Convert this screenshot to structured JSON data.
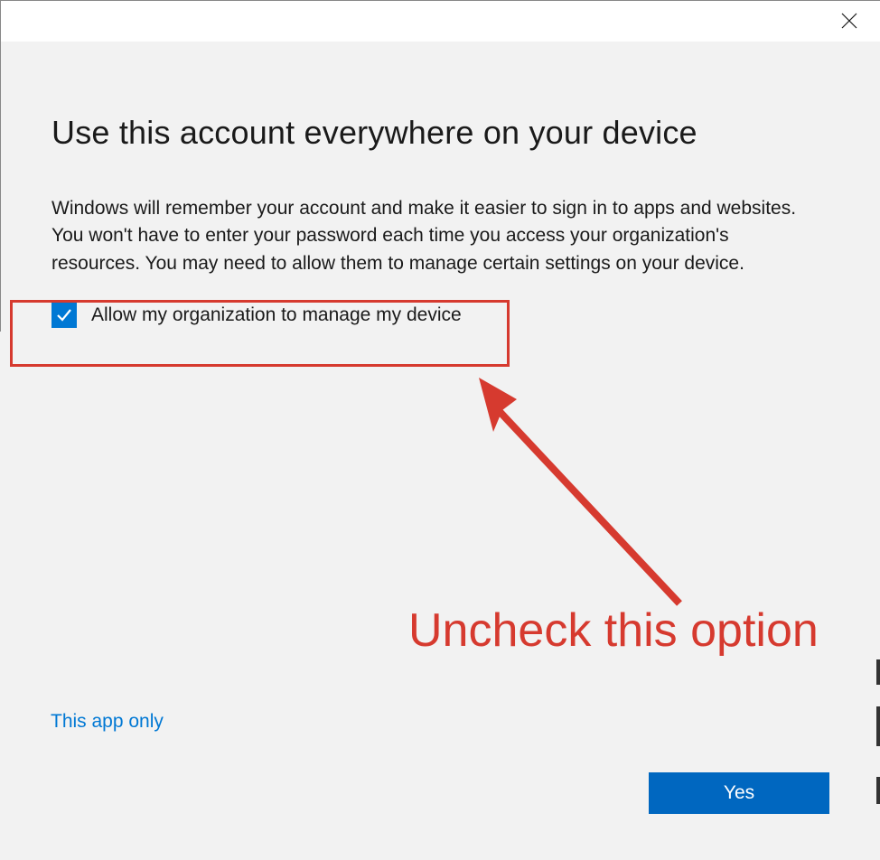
{
  "dialog": {
    "heading": "Use this account everywhere on your device",
    "body": "Windows will remember your account and make it easier to sign in to apps and websites. You won't have to enter your password each time you access your organization's resources. You may need to allow them to manage certain settings on your device.",
    "checkbox": {
      "checked": true,
      "label": "Allow my organization to manage my device"
    },
    "link": "This app only",
    "primary_button": "Yes"
  },
  "annotation": {
    "text": "Uncheck this option",
    "highlight_color": "#d63a2f"
  }
}
